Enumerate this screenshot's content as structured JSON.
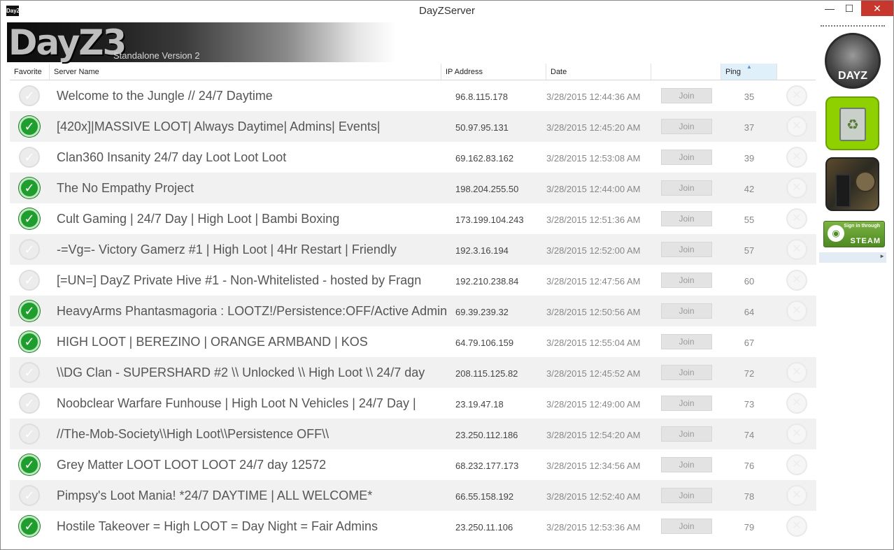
{
  "window": {
    "title": "DayZServer",
    "app_icon": "DayZ",
    "minimize_icon": "minimize-icon",
    "maximize_icon": "maximize-icon",
    "close_icon": "close-icon",
    "minimize_glyph": "—",
    "maximize_glyph": "☐",
    "close_glyph": "✕"
  },
  "banner": {
    "logo_text": "DayZ3",
    "subtitle": "Standalone Version 2"
  },
  "table": {
    "columns": {
      "favorite": "Favorite",
      "server_name": "Server Name",
      "ip_address": "IP Address",
      "date": "Date",
      "join": "",
      "ping": "Ping",
      "remove": ""
    },
    "sorted_column": "Ping",
    "sort_direction": "ascending",
    "join_label": "Join",
    "check_glyph": "✓",
    "remove_glyph": "✕",
    "rows": [
      {
        "favorite": false,
        "name": "Welcome to the Jungle // 24/7 Daytime",
        "ip": "96.8.115.178",
        "date": "3/28/2015 12:44:36 AM",
        "ping": "35",
        "remove": true
      },
      {
        "favorite": true,
        "name": "[420x]|MASSIVE LOOT| Always Daytime| Admins| Events|",
        "ip": "50.97.95.131",
        "date": "3/28/2015 12:45:20 AM",
        "ping": "37",
        "remove": true
      },
      {
        "favorite": false,
        "name": "Clan360 Insanity 24/7 day Loot Loot Loot",
        "ip": "69.162.83.162",
        "date": "3/28/2015 12:53:08 AM",
        "ping": "39",
        "remove": true
      },
      {
        "favorite": true,
        "name": "The No Empathy Project",
        "ip": "198.204.255.50",
        "date": "3/28/2015 12:44:00 AM",
        "ping": "42",
        "remove": true
      },
      {
        "favorite": true,
        "name": "Cult Gaming | 24/7 Day | High Loot | Bambi Boxing",
        "ip": "173.199.104.243",
        "date": "3/28/2015 12:51:36 AM",
        "ping": "55",
        "remove": true
      },
      {
        "favorite": false,
        "name": "-=Vg=- Victory Gamerz #1 | High Loot | 4Hr Restart | Friendly",
        "ip": "192.3.16.194",
        "date": "3/28/2015 12:52:00 AM",
        "ping": "57",
        "remove": true
      },
      {
        "favorite": false,
        "name": "[=UN=] DayZ Private Hive #1 - Non-Whitelisted - hosted by Fragn",
        "ip": "192.210.238.84",
        "date": "3/28/2015 12:47:56 AM",
        "ping": "60",
        "remove": true
      },
      {
        "favorite": true,
        "name": "HeavyArms Phantasmagoria : LOOTZ!/Persistence:OFF/Active Admin",
        "ip": "69.39.239.32",
        "date": "3/28/2015 12:50:56 AM",
        "ping": "64",
        "remove": true
      },
      {
        "favorite": true,
        "name": "HIGH LOOT | BEREZINO | ORANGE ARMBAND | KOS",
        "ip": "64.79.106.159",
        "date": "3/28/2015 12:55:04 AM",
        "ping": "67",
        "remove": false
      },
      {
        "favorite": false,
        "name": "\\\\DG Clan - SUPERSHARD #2 \\\\ Unlocked \\\\ High Loot \\\\ 24/7 day",
        "ip": "208.115.125.82",
        "date": "3/28/2015 12:45:52 AM",
        "ping": "72",
        "remove": true
      },
      {
        "favorite": false,
        "name": "Noobclear Warfare Funhouse | High Loot N Vehicles | 24/7 Day |",
        "ip": "23.19.47.18",
        "date": "3/28/2015 12:49:00 AM",
        "ping": "73",
        "remove": true
      },
      {
        "favorite": false,
        "name": "//The-Mob-Society\\\\High Loot\\\\Persistence OFF\\\\",
        "ip": "23.250.112.186",
        "date": "3/28/2015 12:54:20 AM",
        "ping": "74",
        "remove": true
      },
      {
        "favorite": true,
        "name": "Grey Matter LOOT LOOT LOOT 24/7 day 12572",
        "ip": "68.232.177.173",
        "date": "3/28/2015 12:34:56 AM",
        "ping": "76",
        "remove": true
      },
      {
        "favorite": false,
        "name": "Pimpsy's Loot Mania! *24/7 DAYTIME | ALL WELCOME*",
        "ip": "66.55.158.192",
        "date": "3/28/2015 12:52:40 AM",
        "ping": "78",
        "remove": true
      },
      {
        "favorite": true,
        "name": "Hostile Takeover = High LOOT = Day Night = Fair Admins",
        "ip": "23.250.11.106",
        "date": "3/28/2015 12:53:36 AM",
        "ping": "79",
        "remove": true
      }
    ]
  },
  "sidebar": {
    "dayz_icon_label": "DAYZ",
    "recycle_glyph": "♻",
    "steam": {
      "sign_in_text": "Sign in through",
      "steam_word": "STEAM",
      "steam_glyph": "◉"
    },
    "collapse_glyph": "►"
  },
  "colors": {
    "favorite_on": "#1f9e2e",
    "favorite_off": "#ececec",
    "row_alt": "#f1f1f1",
    "sorted_header": "#dff0fb",
    "close_button": "#c7372d",
    "steam_green": "#5a9a2a"
  }
}
